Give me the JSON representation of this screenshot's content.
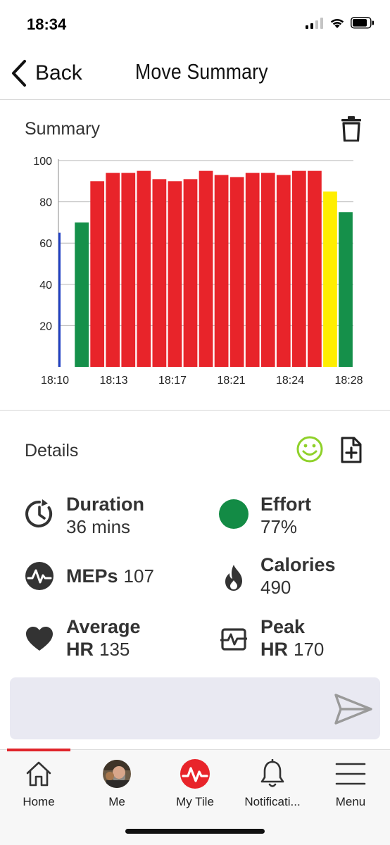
{
  "status": {
    "time": "18:34"
  },
  "nav": {
    "back_label": "Back",
    "title": "Move Summary"
  },
  "summary": {
    "title": "Summary",
    "delete_icon": "trash-icon"
  },
  "chart_data": {
    "type": "bar",
    "title": "",
    "xlabel": "",
    "ylabel": "",
    "ylim": [
      0,
      100
    ],
    "yticks": [
      20,
      40,
      60,
      80,
      100
    ],
    "xtick_labels": [
      "18:10",
      "18:13",
      "18:17",
      "18:21",
      "18:24",
      "18:28"
    ],
    "grid": true,
    "values": [
      65,
      70,
      90,
      94,
      94,
      95,
      91,
      90,
      91,
      95,
      93,
      92,
      94,
      94,
      93,
      95,
      95,
      85,
      75
    ],
    "colors": [
      "#1f3fc4",
      "#15904a",
      "#e8242a",
      "#e8242a",
      "#e8242a",
      "#e8242a",
      "#e8242a",
      "#e8242a",
      "#e8242a",
      "#e8242a",
      "#e8242a",
      "#e8242a",
      "#e8242a",
      "#e8242a",
      "#e8242a",
      "#e8242a",
      "#e8242a",
      "#ffee00",
      "#15904a"
    ]
  },
  "details": {
    "title": "Details",
    "mood_icon": "smiley-icon",
    "add_icon": "add-document-icon",
    "duration": {
      "label": "Duration",
      "value": "36 mins"
    },
    "effort": {
      "label": "Effort",
      "value": "77%",
      "color": "#138b45"
    },
    "meps": {
      "label": "MEPs",
      "value": "107"
    },
    "calories": {
      "label": "Calories",
      "value": "490"
    },
    "avg_hr": {
      "label_line1": "Average",
      "label_line2": "HR",
      "value": "135"
    },
    "peak_hr": {
      "label_line1": "Peak",
      "label_line2": "HR",
      "value": "170"
    }
  },
  "message": {
    "placeholder": "",
    "send_icon": "send-icon"
  },
  "tabs": [
    {
      "label": "Home",
      "icon": "home-icon"
    },
    {
      "label": "Me",
      "icon": "avatar"
    },
    {
      "label": "My Tile",
      "icon": "my-tile-icon"
    },
    {
      "label": "Notificati...",
      "icon": "bell-icon"
    },
    {
      "label": "Menu",
      "icon": "menu-icon"
    }
  ],
  "colors": {
    "accent": "#e0242a",
    "smiley": "#8fd12a",
    "text": "#333333"
  }
}
